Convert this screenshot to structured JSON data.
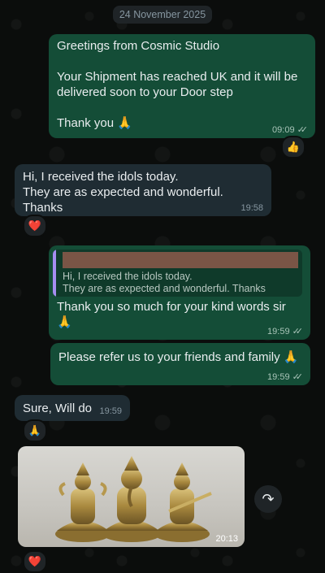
{
  "date_label": "24 November 2025",
  "messages": [
    {
      "direction": "out",
      "text": "Greetings from Cosmic Studio\n\nYour Shipment has reached UK and it will be delivered soon to your Door step\n\nThank you 🙏",
      "time": "09:09",
      "reaction": "👍"
    },
    {
      "direction": "in",
      "text": "Hi, I received the idols today.\nThey are as expected and wonderful. Thanks",
      "time": "19:58",
      "reaction": "❤️"
    },
    {
      "direction": "out",
      "quoted": "Hi, I received the idols today.\nThey are as expected and wonderful. Thanks",
      "text": "Thank you so much for your kind words sir\n🙏",
      "time": "19:59"
    },
    {
      "direction": "out",
      "text": "Please refer us to your friends and family 🙏",
      "time": "19:59"
    },
    {
      "direction": "in",
      "text": "Sure, Will do",
      "time": "19:59",
      "reaction": "🙏"
    },
    {
      "direction": "in",
      "type": "image",
      "image_desc": "three brass idols",
      "time": "20:13",
      "reaction": "❤️"
    }
  ],
  "icons": {
    "read": "double-check-icon",
    "forward": "forward-icon"
  },
  "colors": {
    "bg": "#0b0d0c",
    "outgoing": "#144d37",
    "incoming": "#1f2c33",
    "quote_bar": "#a58df0"
  },
  "ticks": "✓✓",
  "forward_glyph": "↷"
}
